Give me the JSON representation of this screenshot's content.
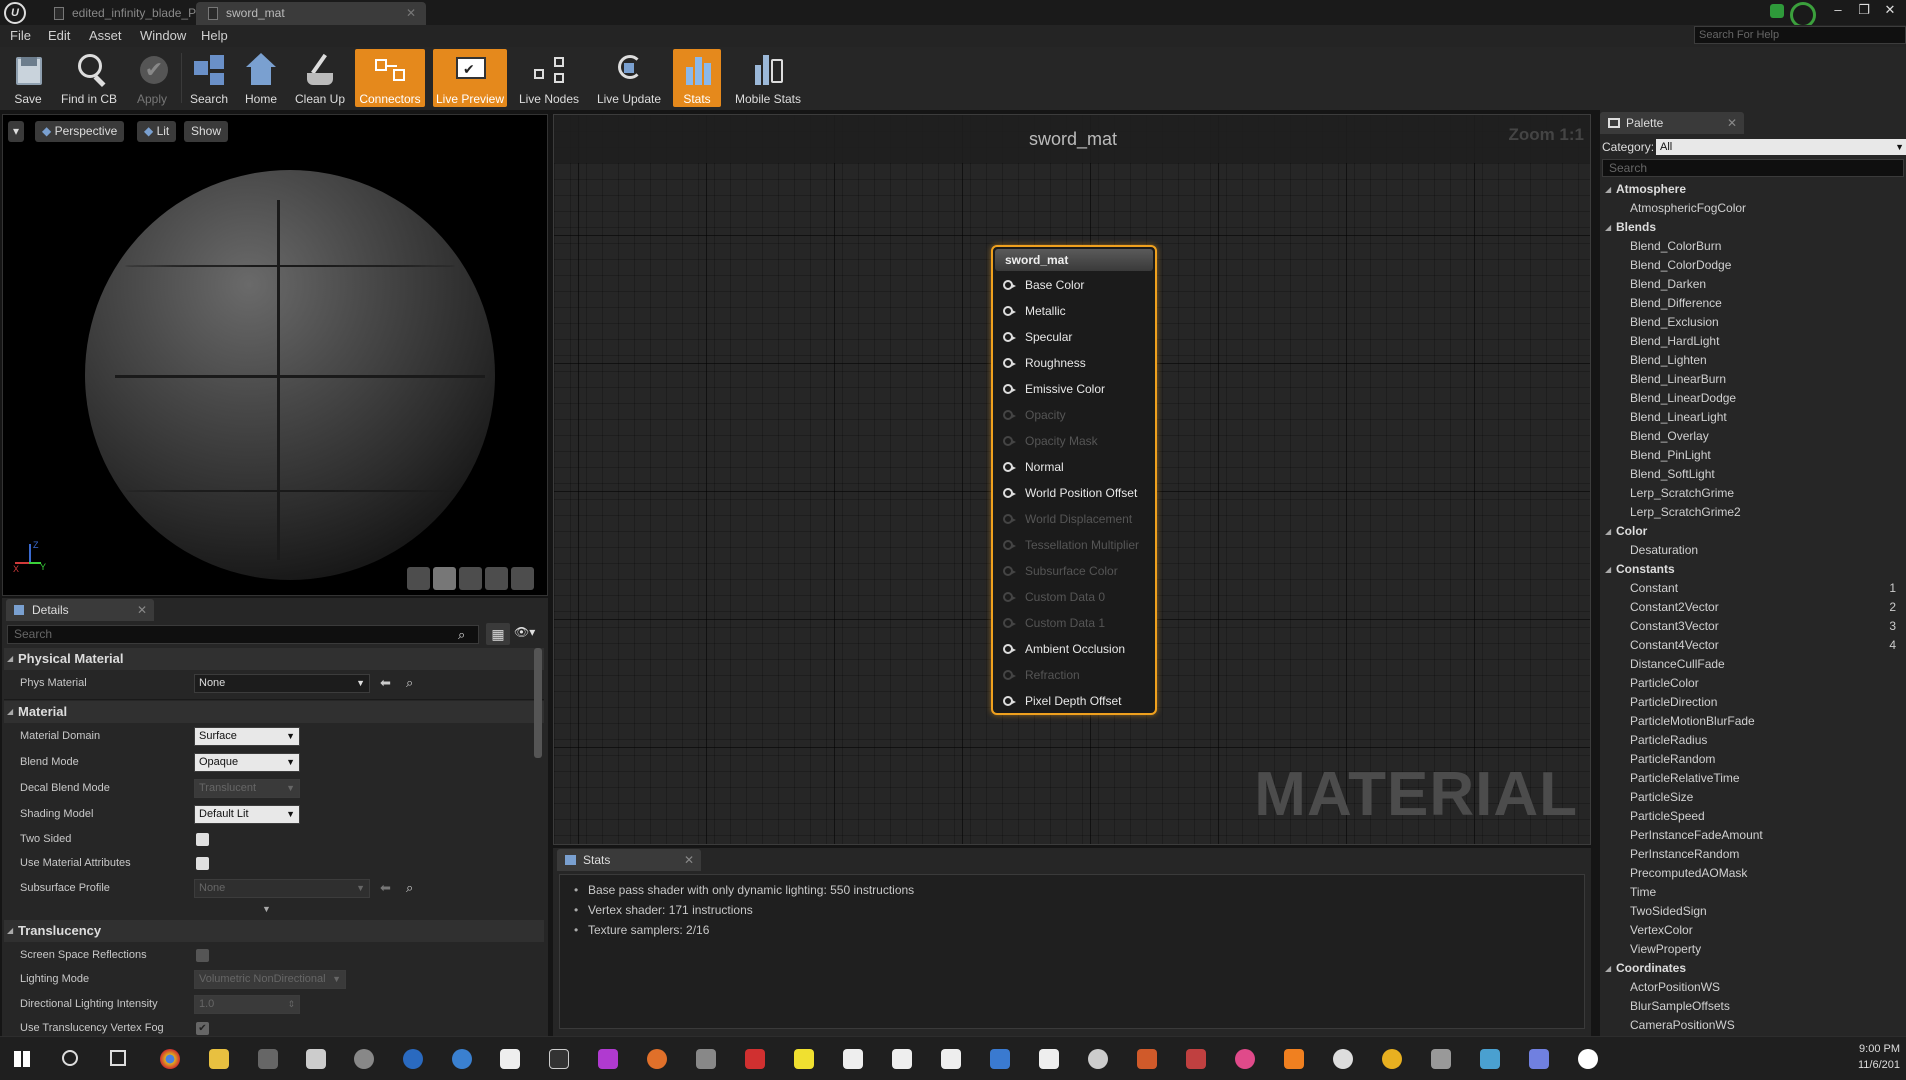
{
  "titlebar": {
    "tab1": "edited_infinity_blade_Phys",
    "tab2": "sword_mat"
  },
  "menu": [
    "File",
    "Edit",
    "Asset",
    "Window",
    "Help"
  ],
  "help_search_placeholder": "Search For Help",
  "toolbar": {
    "save": "Save",
    "find_in_cb": "Find in CB",
    "apply": "Apply",
    "search": "Search",
    "home": "Home",
    "clean_up": "Clean Up",
    "connectors": "Connectors",
    "live_preview": "Live Preview",
    "live_nodes": "Live Nodes",
    "live_update": "Live Update",
    "stats": "Stats",
    "mobile_stats": "Mobile Stats"
  },
  "viewport": {
    "perspective": "Perspective",
    "lit": "Lit",
    "show": "Show",
    "axis_x": "X",
    "axis_y": "Y",
    "axis_z": "Z"
  },
  "details": {
    "tab": "Details",
    "search_placeholder": "Search",
    "phys_cat": "Physical Material",
    "phys_material_label": "Phys Material",
    "phys_material_value": "None",
    "material_cat": "Material",
    "material_domain_label": "Material Domain",
    "material_domain_value": "Surface",
    "blend_mode_label": "Blend Mode",
    "blend_mode_value": "Opaque",
    "decal_blend_label": "Decal Blend Mode",
    "decal_blend_value": "Translucent",
    "shading_label": "Shading Model",
    "shading_value": "Default Lit",
    "two_sided_label": "Two Sided",
    "use_mat_attr_label": "Use Material Attributes",
    "subsurface_label": "Subsurface Profile",
    "subsurface_value": "None",
    "translucency_cat": "Translucency",
    "ssr_label": "Screen Space Reflections",
    "lighting_mode_label": "Lighting Mode",
    "lighting_mode_value": "Volumetric NonDirectional",
    "dir_light_label": "Directional Lighting Intensity",
    "dir_light_value": "1.0",
    "vertex_fog_label": "Use Translucency Vertex Fog"
  },
  "graph": {
    "title": "sword_mat",
    "zoom": "Zoom 1:1",
    "watermark": "MATERIAL",
    "node_title": "sword_mat",
    "pins": [
      {
        "label": "Base Color",
        "enabled": true
      },
      {
        "label": "Metallic",
        "enabled": true
      },
      {
        "label": "Specular",
        "enabled": true
      },
      {
        "label": "Roughness",
        "enabled": true
      },
      {
        "label": "Emissive Color",
        "enabled": true
      },
      {
        "label": "Opacity",
        "enabled": false
      },
      {
        "label": "Opacity Mask",
        "enabled": false
      },
      {
        "label": "Normal",
        "enabled": true
      },
      {
        "label": "World Position Offset",
        "enabled": true
      },
      {
        "label": "World Displacement",
        "enabled": false
      },
      {
        "label": "Tessellation Multiplier",
        "enabled": false
      },
      {
        "label": "Subsurface Color",
        "enabled": false
      },
      {
        "label": "Custom Data 0",
        "enabled": false
      },
      {
        "label": "Custom Data 1",
        "enabled": false
      },
      {
        "label": "Ambient Occlusion",
        "enabled": true
      },
      {
        "label": "Refraction",
        "enabled": false
      },
      {
        "label": "Pixel Depth Offset",
        "enabled": true
      }
    ]
  },
  "stats": {
    "tab": "Stats",
    "lines": [
      "Base pass shader with only dynamic lighting: 550 instructions",
      "Vertex shader: 171 instructions",
      "Texture samplers: 2/16"
    ]
  },
  "palette": {
    "tab": "Palette",
    "category_label": "Category:",
    "category_value": "All",
    "search_placeholder": "Search",
    "rows": [
      {
        "t": "cat",
        "label": "Atmosphere"
      },
      {
        "t": "item",
        "label": "AtmosphericFogColor"
      },
      {
        "t": "cat",
        "label": "Blends"
      },
      {
        "t": "item",
        "label": "Blend_ColorBurn"
      },
      {
        "t": "item",
        "label": "Blend_ColorDodge"
      },
      {
        "t": "item",
        "label": "Blend_Darken"
      },
      {
        "t": "item",
        "label": "Blend_Difference"
      },
      {
        "t": "item",
        "label": "Blend_Exclusion"
      },
      {
        "t": "item",
        "label": "Blend_HardLight"
      },
      {
        "t": "item",
        "label": "Blend_Lighten"
      },
      {
        "t": "item",
        "label": "Blend_LinearBurn"
      },
      {
        "t": "item",
        "label": "Blend_LinearDodge"
      },
      {
        "t": "item",
        "label": "Blend_LinearLight"
      },
      {
        "t": "item",
        "label": "Blend_Overlay"
      },
      {
        "t": "item",
        "label": "Blend_PinLight"
      },
      {
        "t": "item",
        "label": "Blend_SoftLight"
      },
      {
        "t": "item",
        "label": "Lerp_ScratchGrime"
      },
      {
        "t": "item",
        "label": "Lerp_ScratchGrime2"
      },
      {
        "t": "cat",
        "label": "Color"
      },
      {
        "t": "item",
        "label": "Desaturation"
      },
      {
        "t": "cat",
        "label": "Constants"
      },
      {
        "t": "item",
        "label": "Constant",
        "sc": "1"
      },
      {
        "t": "item",
        "label": "Constant2Vector",
        "sc": "2"
      },
      {
        "t": "item",
        "label": "Constant3Vector",
        "sc": "3"
      },
      {
        "t": "item",
        "label": "Constant4Vector",
        "sc": "4"
      },
      {
        "t": "item",
        "label": "DistanceCullFade"
      },
      {
        "t": "item",
        "label": "ParticleColor"
      },
      {
        "t": "item",
        "label": "ParticleDirection"
      },
      {
        "t": "item",
        "label": "ParticleMotionBlurFade"
      },
      {
        "t": "item",
        "label": "ParticleRadius"
      },
      {
        "t": "item",
        "label": "ParticleRandom"
      },
      {
        "t": "item",
        "label": "ParticleRelativeTime"
      },
      {
        "t": "item",
        "label": "ParticleSize"
      },
      {
        "t": "item",
        "label": "ParticleSpeed"
      },
      {
        "t": "item",
        "label": "PerInstanceFadeAmount"
      },
      {
        "t": "item",
        "label": "PerInstanceRandom"
      },
      {
        "t": "item",
        "label": "PrecomputedAOMask"
      },
      {
        "t": "item",
        "label": "Time"
      },
      {
        "t": "item",
        "label": "TwoSidedSign"
      },
      {
        "t": "item",
        "label": "VertexColor"
      },
      {
        "t": "item",
        "label": "ViewProperty"
      },
      {
        "t": "cat",
        "label": "Coordinates"
      },
      {
        "t": "item",
        "label": "ActorPositionWS"
      },
      {
        "t": "item",
        "label": "BlurSampleOffsets"
      },
      {
        "t": "item",
        "label": "CameraPositionWS"
      }
    ]
  },
  "taskbar": {
    "time": "9:00 PM",
    "date": "11/6/201"
  },
  "colors": {
    "accent": "#e5891c",
    "node_border": "#f0a11e"
  }
}
